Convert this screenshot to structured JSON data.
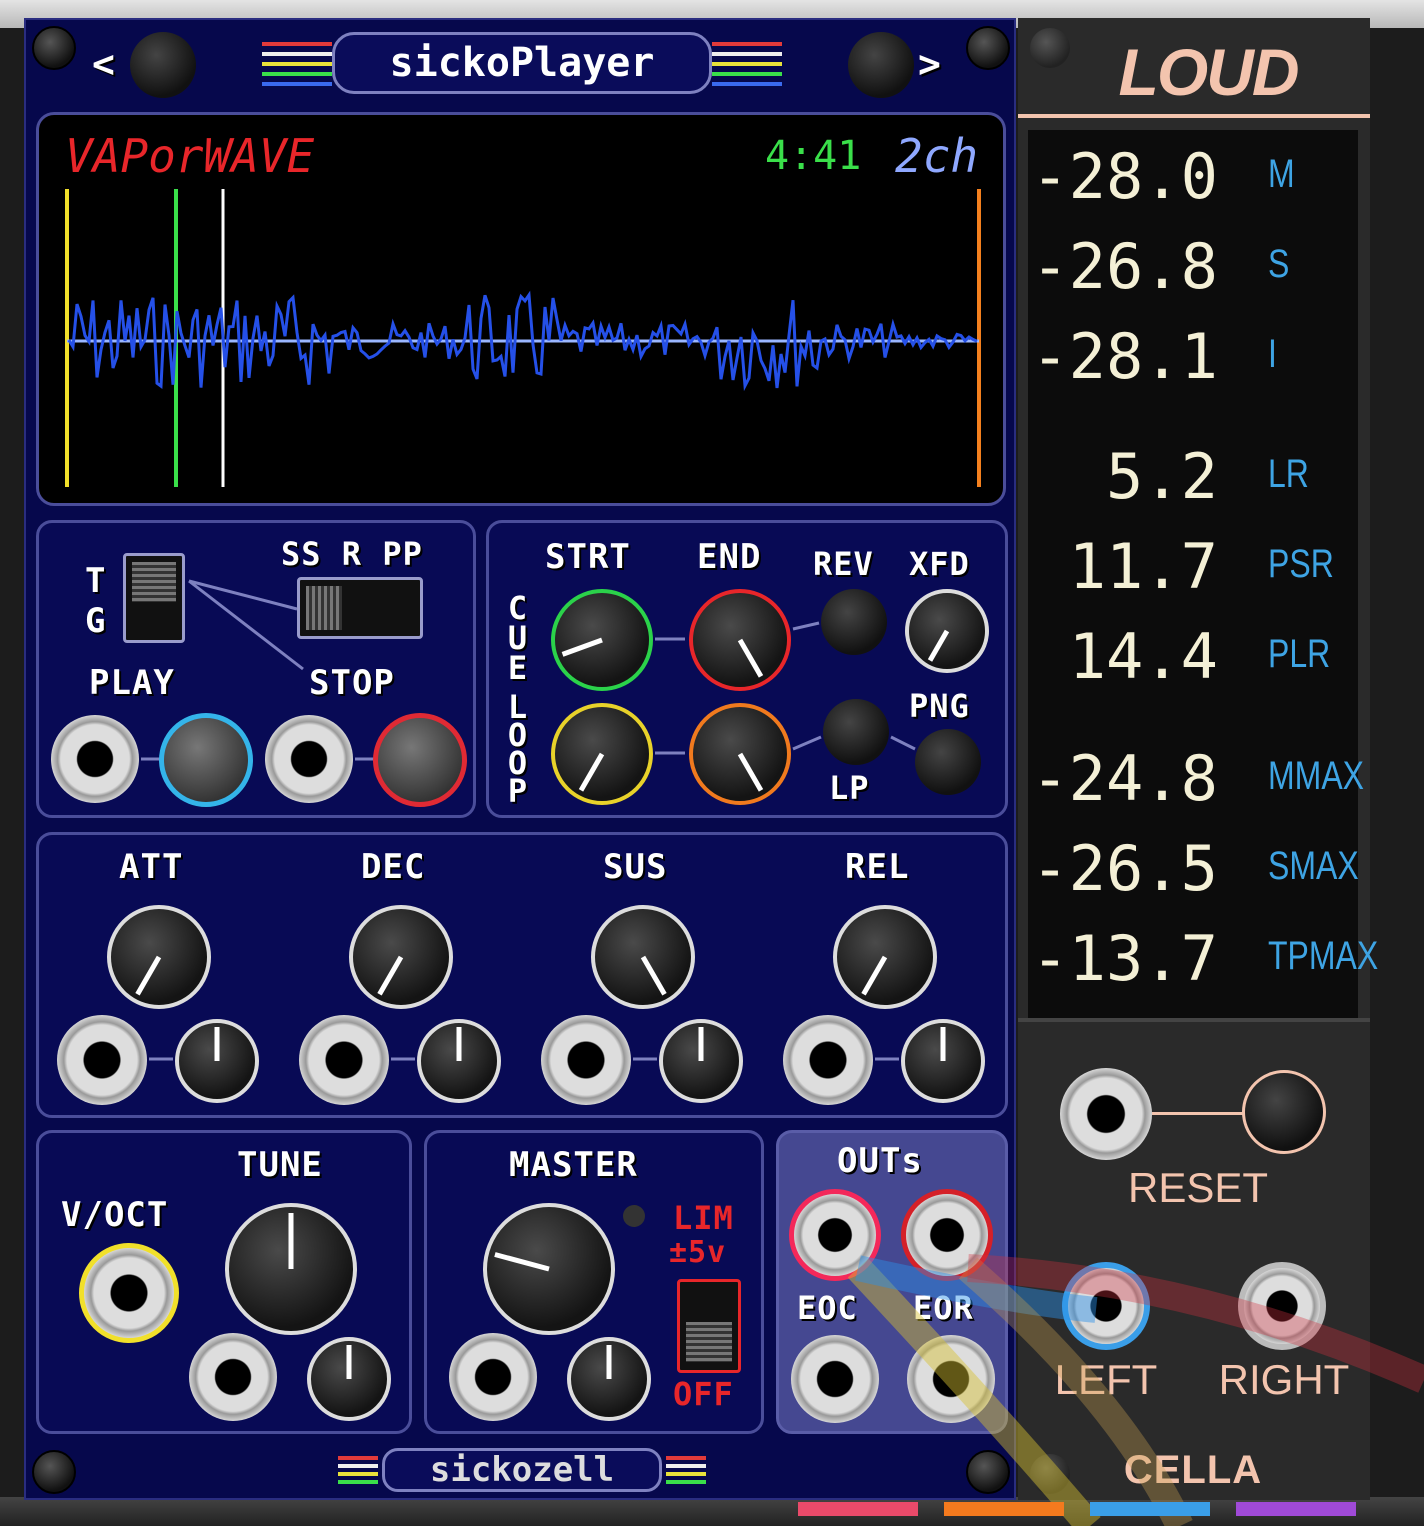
{
  "colors": {
    "panel_bg": "#06084c",
    "loud_bg": "#2a2a2a",
    "loud_accent": "#f3c4ae",
    "unit_blue": "#3ea4e4"
  },
  "header": {
    "title": "sickoPlayer",
    "prev_label": "<",
    "next_label": ">"
  },
  "display": {
    "sample_name": "VAPorWAVE",
    "time": "4:41",
    "channels": "2ch"
  },
  "trig": {
    "mode_top": "T",
    "mode_bottom": "G",
    "mode_options": "SS R PP",
    "play_label": "PLAY",
    "stop_label": "STOP"
  },
  "cue": {
    "vertical_cue": "CUE",
    "vertical_loop": "LOOP",
    "start_label": "STRT",
    "end_label": "END",
    "rev_label": "REV",
    "xfd_label": "XFD",
    "lp_label": "LP",
    "png_label": "PNG"
  },
  "envelope": {
    "att": "ATT",
    "dec": "DEC",
    "sus": "SUS",
    "rel": "REL"
  },
  "tune": {
    "title": "TUNE",
    "voct": "V/OCT"
  },
  "master": {
    "title": "MASTER",
    "lim": "LIM",
    "lim_range": "±5v",
    "off": "OFF"
  },
  "outs": {
    "title": "OUTs",
    "eoc": "EOC",
    "eor": "EOR"
  },
  "footer": {
    "brand": "sickozell"
  },
  "loud": {
    "title": "LOUD",
    "readings": [
      {
        "value": "-28.0",
        "unit": "M"
      },
      {
        "value": "-26.8",
        "unit": "S"
      },
      {
        "value": "-28.1",
        "unit": "I"
      },
      {
        "value": "5.2",
        "unit": "LR"
      },
      {
        "value": "11.7",
        "unit": "PSR"
      },
      {
        "value": "14.4",
        "unit": "PLR"
      },
      {
        "value": "-24.8",
        "unit": "MMAX"
      },
      {
        "value": "-26.5",
        "unit": "SMAX"
      },
      {
        "value": "-13.7",
        "unit": "TPMAX"
      }
    ],
    "reset_label": "RESET",
    "left_label": "LEFT",
    "right_label": "RIGHT",
    "brand": "CELLA"
  }
}
